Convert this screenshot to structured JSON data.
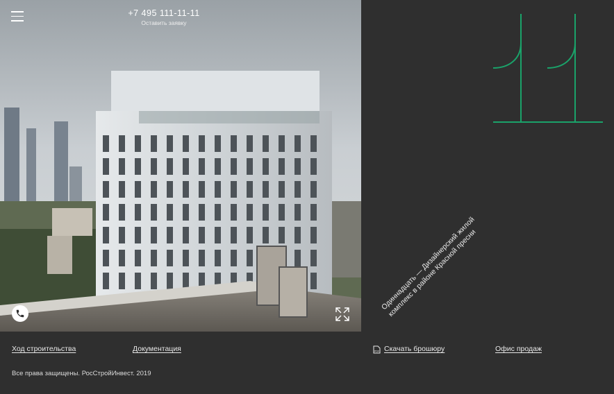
{
  "header": {
    "phone": "+7 495 111-11-11",
    "request_label": "Оставить заявку"
  },
  "brand": {
    "logo_icon": "eleven-logo",
    "accent_color": "#1aa36a",
    "tagline": "Одиннадцать — Дизайнерский жилой комплекс в районе Красной пресни"
  },
  "footer": {
    "links": {
      "construction": "Ход строительства",
      "documents": "Документация",
      "brochure": "Скачать брошюру",
      "sales_office": "Офис продаж"
    },
    "brochure_icon": "pdf-icon",
    "copyright": "Все права защищены. РосСтройИнвест. 2019"
  },
  "icons": {
    "menu": "menu-icon",
    "call": "phone-icon",
    "expand": "expand-icon"
  },
  "colors": {
    "background": "#2f2f2f",
    "text": "#e8e8e8"
  }
}
